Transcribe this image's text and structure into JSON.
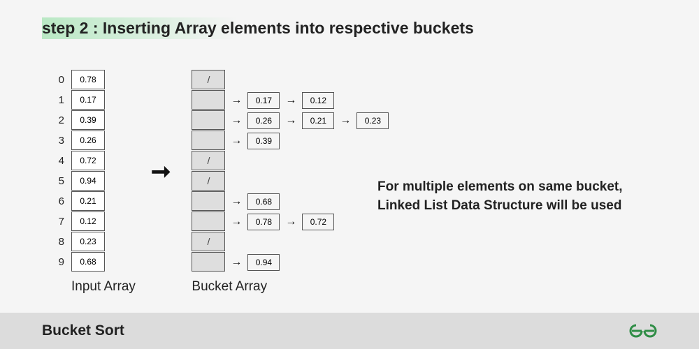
{
  "title": "step 2 : Inserting Array elements into respective buckets",
  "indices": [
    "0",
    "1",
    "2",
    "3",
    "4",
    "5",
    "6",
    "7",
    "8",
    "9"
  ],
  "input_array": [
    "0.78",
    "0.17",
    "0.39",
    "0.26",
    "0.72",
    "0.94",
    "0.21",
    "0.12",
    "0.23",
    "0.68"
  ],
  "buckets": [
    {
      "slash": true,
      "chain": []
    },
    {
      "slash": false,
      "chain": [
        "0.17",
        "0.12"
      ]
    },
    {
      "slash": false,
      "chain": [
        "0.26",
        "0.21",
        "0.23"
      ]
    },
    {
      "slash": false,
      "chain": [
        "0.39"
      ]
    },
    {
      "slash": true,
      "chain": []
    },
    {
      "slash": true,
      "chain": []
    },
    {
      "slash": false,
      "chain": [
        "0.68"
      ]
    },
    {
      "slash": false,
      "chain": [
        "0.78",
        "0.72"
      ]
    },
    {
      "slash": true,
      "chain": []
    },
    {
      "slash": false,
      "chain": [
        "0.94"
      ]
    }
  ],
  "input_label": "Input Array",
  "bucket_label": "Bucket Array",
  "explanation_line1": "For multiple elements on same bucket,",
  "explanation_line2": "Linked List Data Structure will be used",
  "footer_title": "Bucket Sort",
  "slash_symbol": "/",
  "arrow_symbol": "→"
}
